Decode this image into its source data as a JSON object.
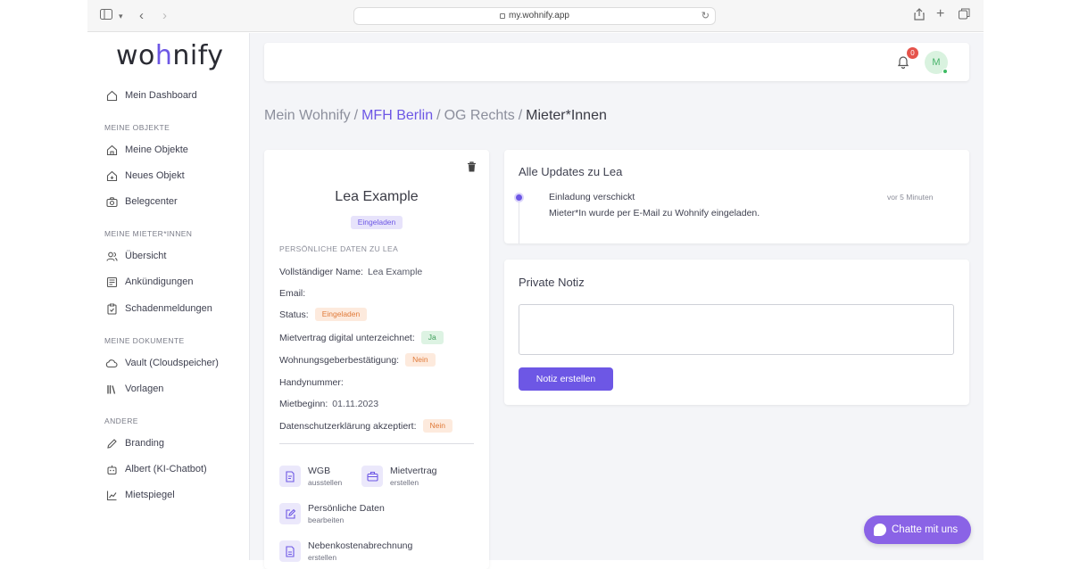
{
  "browser": {
    "url": "my.wohnify.app"
  },
  "sidebar": {
    "logo": {
      "before": "wo",
      "accent": "h",
      "after": "nify"
    },
    "dashboard": {
      "label": "Mein Dashboard"
    },
    "sections": [
      {
        "title": "MEINE OBJEKTE",
        "items": [
          {
            "label": "Meine Objekte",
            "icon": "house-icon"
          },
          {
            "label": "Neues Objekt",
            "icon": "house-plus-icon"
          },
          {
            "label": "Belegcenter",
            "icon": "camera-icon"
          }
        ]
      },
      {
        "title": "MEINE MIETER*INNEN",
        "items": [
          {
            "label": "Übersicht",
            "icon": "users-icon"
          },
          {
            "label": "Ankündigungen",
            "icon": "newspaper-icon"
          },
          {
            "label": "Schadenmeldungen",
            "icon": "clipboard-icon"
          }
        ]
      },
      {
        "title": "MEINE DOKUMENTE",
        "items": [
          {
            "label": "Vault (Cloudspeicher)",
            "icon": "cloud-icon"
          },
          {
            "label": "Vorlagen",
            "icon": "library-icon"
          }
        ]
      },
      {
        "title": "ANDERE",
        "items": [
          {
            "label": "Branding",
            "icon": "pen-icon"
          },
          {
            "label": "Albert (KI-Chatbot)",
            "icon": "robot-icon"
          },
          {
            "label": "Mietspiegel",
            "icon": "chart-icon"
          }
        ]
      }
    ]
  },
  "topbar": {
    "notification_count": "0",
    "avatar_initial": "M"
  },
  "breadcrumb": {
    "root": "Mein Wohnify",
    "sep": "/",
    "object": "MFH Berlin",
    "unit": "OG Rechts",
    "current": "Mieter*Innen"
  },
  "profile": {
    "name": "Lea Example",
    "status_badge": "Eingeladen",
    "section_label": "PERSÖNLICHE DATEN ZU LEA",
    "fields": {
      "full_name_label": "Vollständiger Name:",
      "full_name_value": "Lea Example",
      "email_label": "Email:",
      "status_label": "Status:",
      "status_value": "Eingeladen",
      "contract_label": "Mietvertrag digital unterzeichnet:",
      "contract_value": "Ja",
      "confirmation_label": "Wohnungsgeberbestätigung:",
      "confirmation_value": "Nein",
      "phone_label": "Handynummer:",
      "start_label": "Mietbeginn:",
      "start_value": "01.11.2023",
      "privacy_label": "Datenschutzerklärung akzeptiert:",
      "privacy_value": "Nein"
    },
    "actions": {
      "wgb": {
        "title": "WGB",
        "sub": "ausstellen"
      },
      "contract": {
        "title": "Mietvertrag",
        "sub": "erstellen"
      },
      "personal": {
        "title": "Persönliche Daten",
        "sub": "bearbeiten"
      },
      "utility": {
        "title": "Nebenkostenabrechnung",
        "sub": "erstellen"
      }
    }
  },
  "updates": {
    "title": "Alle Updates zu Lea",
    "items": [
      {
        "title": "Einladung verschickt",
        "time": "vor 5 Minuten",
        "text": "Mieter*In wurde per E-Mail zu Wohnify eingeladen."
      }
    ]
  },
  "note": {
    "title": "Private Notiz",
    "value": "",
    "button_label": "Notiz erstellen"
  },
  "chat": {
    "label": "Chatte mit uns"
  },
  "colors": {
    "accent": "#6d57e5",
    "chat": "#8a63e6",
    "status_orange": "#e07b3a",
    "status_green": "#3a9b57",
    "notification_red": "#e5534b"
  }
}
